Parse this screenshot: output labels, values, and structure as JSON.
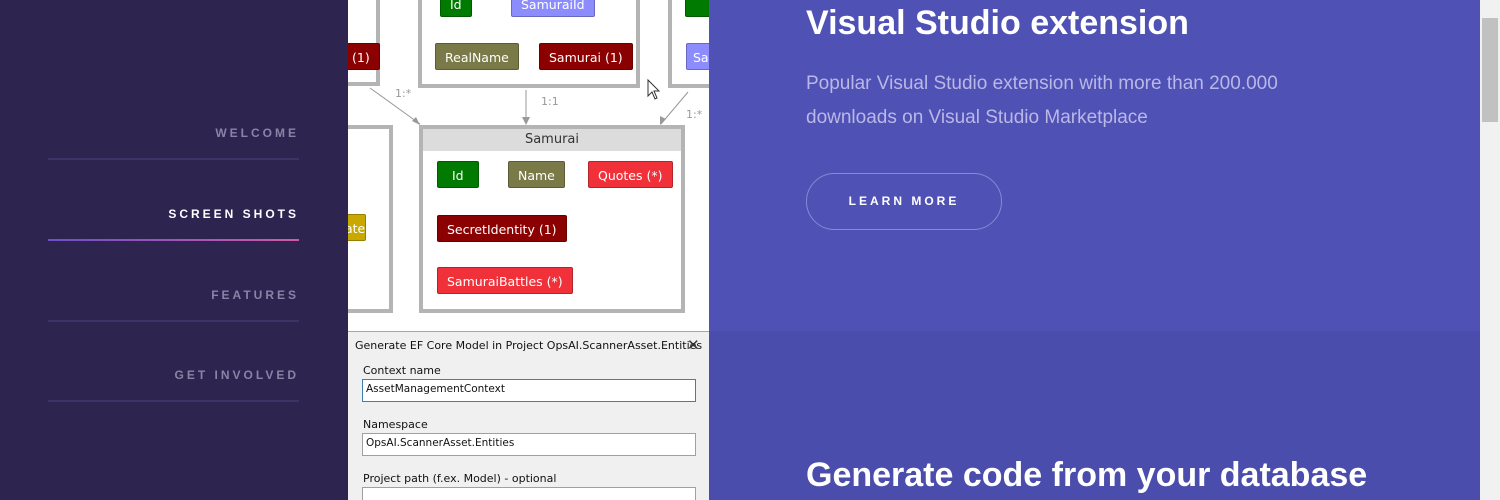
{
  "sidebar": {
    "items": [
      {
        "label": "WELCOME"
      },
      {
        "label": "SCREEN SHOTS"
      },
      {
        "label": "FEATURES"
      },
      {
        "label": "GET INVOLVED"
      }
    ]
  },
  "diagram": {
    "top_chips": [
      "Id",
      "SamuraiId",
      "RealName",
      "Samurai (1)",
      "(1)",
      "Sa"
    ],
    "relations": [
      "1:*",
      "1:1",
      "1:*"
    ],
    "samurai_entity": {
      "title": "Samurai",
      "chips": [
        "Id",
        "Name",
        "Quotes (*)",
        "SecretIdentity (1)",
        "SamuraiBattles (*)"
      ]
    },
    "left_chip": "ate"
  },
  "dialog": {
    "title": "Generate EF Core Model in Project OpsAI.ScannerAsset.Entities",
    "close": "✕",
    "context_label": "Context name",
    "context_value": "AssetManagementContext",
    "namespace_label": "Namespace",
    "namespace_value": "OpsAI.ScannerAsset.Entities",
    "path_label": "Project path (f.ex. Model) - optional",
    "path_value": ""
  },
  "hero": {
    "title": "Visual Studio extension",
    "description": "Popular Visual Studio extension with more than 200.000 downloads on Visual Studio Marketplace",
    "button": "LEARN MORE"
  },
  "next_section": {
    "title": "Generate code from your database"
  },
  "colors": {
    "sidebar_bg": "#2d2450",
    "hero_bg": "#4f51b5",
    "accent_gradient_start": "#6c4fc8",
    "accent_gradient_end": "#d15aa8"
  }
}
